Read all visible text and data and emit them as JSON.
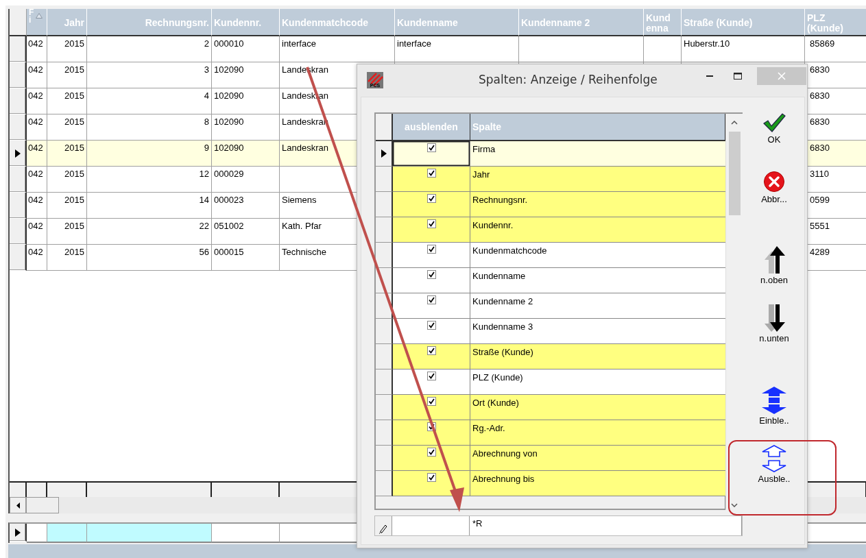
{
  "main_grid": {
    "columns": [
      {
        "label": "F i",
        "sorted": true
      },
      {
        "label": "Jahr",
        "sorted": false
      },
      {
        "label": "Rechnungsnr.",
        "sorted": false
      },
      {
        "label": "Kundennr.",
        "sorted": false
      },
      {
        "label": "Kundenmatchcode",
        "sorted": false
      },
      {
        "label": "Kundenname",
        "sorted": false
      },
      {
        "label": "Kundenname 2",
        "sorted": false
      },
      {
        "label": "Kund enna",
        "sorted": false
      },
      {
        "label": "Straße (Kunde)",
        "sorted": false
      },
      {
        "label": "PLZ (Kunde)",
        "sorted": false
      }
    ],
    "rows": [
      {
        "selected": false,
        "cells": [
          "042",
          "2015",
          "2",
          "000010",
          "interface",
          "interface",
          "",
          "",
          "Huberstr.10",
          "85869"
        ]
      },
      {
        "selected": false,
        "cells": [
          "042",
          "2015",
          "3",
          "102090",
          "Landeskran",
          "",
          "",
          "",
          "",
          "6830"
        ]
      },
      {
        "selected": false,
        "cells": [
          "042",
          "2015",
          "4",
          "102090",
          "Landeskran",
          "",
          "",
          "",
          "",
          "6830"
        ]
      },
      {
        "selected": false,
        "cells": [
          "042",
          "2015",
          "8",
          "102090",
          "Landeskran",
          "",
          "",
          "",
          "",
          "6830"
        ]
      },
      {
        "selected": true,
        "cells": [
          "042",
          "2015",
          "9",
          "102090",
          "Landeskran",
          "",
          "",
          "",
          "",
          "6830"
        ]
      },
      {
        "selected": false,
        "cells": [
          "042",
          "2015",
          "12",
          "000029",
          "",
          "",
          "",
          "",
          "",
          "3110"
        ]
      },
      {
        "selected": false,
        "cells": [
          "042",
          "2015",
          "14",
          "000023",
          "Siemens",
          "",
          "",
          "",
          "",
          "0599"
        ]
      },
      {
        "selected": false,
        "cells": [
          "042",
          "2015",
          "22",
          "051002",
          "Kath. Pfar",
          "",
          "",
          "",
          "",
          "5551"
        ]
      },
      {
        "selected": false,
        "cells": [
          "042",
          "2015",
          "56",
          "000015",
          "Technische",
          "",
          "",
          "",
          "",
          "4289"
        ]
      }
    ],
    "filter_row": [
      {
        "highlighted": false
      },
      {
        "highlighted": true
      },
      {
        "highlighted": true
      },
      {
        "highlighted": false
      },
      {
        "highlighted": false
      }
    ]
  },
  "dialog": {
    "logo_text": "PCS",
    "title": "Spalten: Anzeige / Reihenfolge",
    "columns": [
      "ausblenden",
      "Spalte"
    ],
    "rows": [
      {
        "label": "Firma",
        "checked": true,
        "highlighted": true,
        "selected": true
      },
      {
        "label": "Jahr",
        "checked": true,
        "highlighted": true,
        "selected": false
      },
      {
        "label": "Rechnungsnr.",
        "checked": true,
        "highlighted": true,
        "selected": false
      },
      {
        "label": "Kundennr.",
        "checked": true,
        "highlighted": true,
        "selected": false
      },
      {
        "label": "Kundenmatchcode",
        "checked": true,
        "highlighted": false,
        "selected": false
      },
      {
        "label": "Kundenname",
        "checked": true,
        "highlighted": false,
        "selected": false
      },
      {
        "label": "Kundenname 2",
        "checked": true,
        "highlighted": false,
        "selected": false
      },
      {
        "label": "Kundenname 3",
        "checked": true,
        "highlighted": false,
        "selected": false
      },
      {
        "label": "Straße (Kunde)",
        "checked": true,
        "highlighted": true,
        "selected": false
      },
      {
        "label": "PLZ (Kunde)",
        "checked": true,
        "highlighted": false,
        "selected": false
      },
      {
        "label": "Ort (Kunde)",
        "checked": true,
        "highlighted": true,
        "selected": false
      },
      {
        "label": "Rg.-Adr.",
        "checked": true,
        "highlighted": true,
        "selected": false
      },
      {
        "label": "Abrechnung von",
        "checked": true,
        "highlighted": true,
        "selected": false
      },
      {
        "label": "Abrechnung bis",
        "checked": true,
        "highlighted": true,
        "selected": false
      }
    ],
    "new_row": {
      "value": "*R"
    },
    "actions": [
      {
        "kind": "ok",
        "label": "OK"
      },
      {
        "kind": "cancel",
        "label": "Abbr..."
      },
      {
        "kind": "up",
        "label": "n.oben"
      },
      {
        "kind": "down",
        "label": "n.unten"
      },
      {
        "kind": "show_all",
        "label": "Einble.."
      },
      {
        "kind": "hide_all",
        "label": "Ausble.."
      }
    ]
  }
}
